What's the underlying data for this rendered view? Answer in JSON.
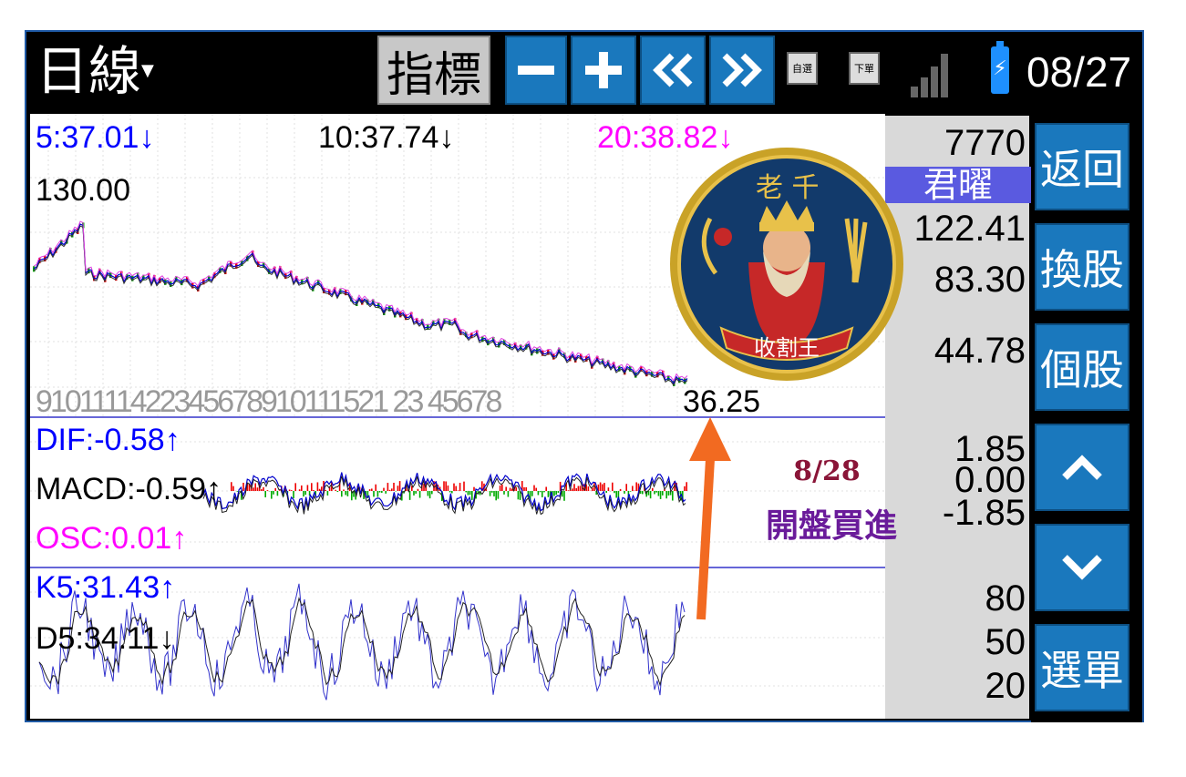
{
  "header": {
    "period_label": "日線",
    "indicator_button": "指標",
    "zoom_out_glyph": "−",
    "zoom_in_glyph": "+",
    "prev_glyph": "«",
    "next_glyph": "»",
    "watchlist_icon_label": "自選",
    "order_icon_label": "下單",
    "date": "08/27"
  },
  "price_panel": {
    "ma5": "5:37.01↓",
    "ma10": "10:37.74↓",
    "ma20": "20:38.82↓",
    "top_value": "130.00",
    "last_price": "36.25",
    "month_ticks": "9101111422345678910111521 23 45678"
  },
  "macd_panel": {
    "dif": "DIF:-0.58↑",
    "macd": "MACD:-0.59↑",
    "osc": "OSC:0.01↑"
  },
  "kd_panel": {
    "k": "K5:31.43↑",
    "d": "D5:34.11↓"
  },
  "scale": {
    "stock_code": "7770",
    "stock_name": "君曜",
    "price_high": "122.41",
    "price_mid": "83.30",
    "price_low": "44.78",
    "macd_high": "1.85",
    "macd_mid": "0.00",
    "macd_low": "-1.85",
    "kd_80": "80",
    "kd_50": "50",
    "kd_20": "20"
  },
  "side_buttons": {
    "back": "返回",
    "switch": "換股",
    "single": "個股",
    "menu": "選單"
  },
  "medal": {
    "top_text": "老 千",
    "bottom_text": "收割王"
  },
  "annotation": {
    "date": "8/28",
    "text": "開盤買進"
  },
  "colors": {
    "ma5": "#0000ff",
    "ma10": "#000000",
    "ma20": "#ff00ff",
    "osc": "#ff0000",
    "button_blue": "#1a78bd",
    "arrow": "#f26a21"
  }
}
